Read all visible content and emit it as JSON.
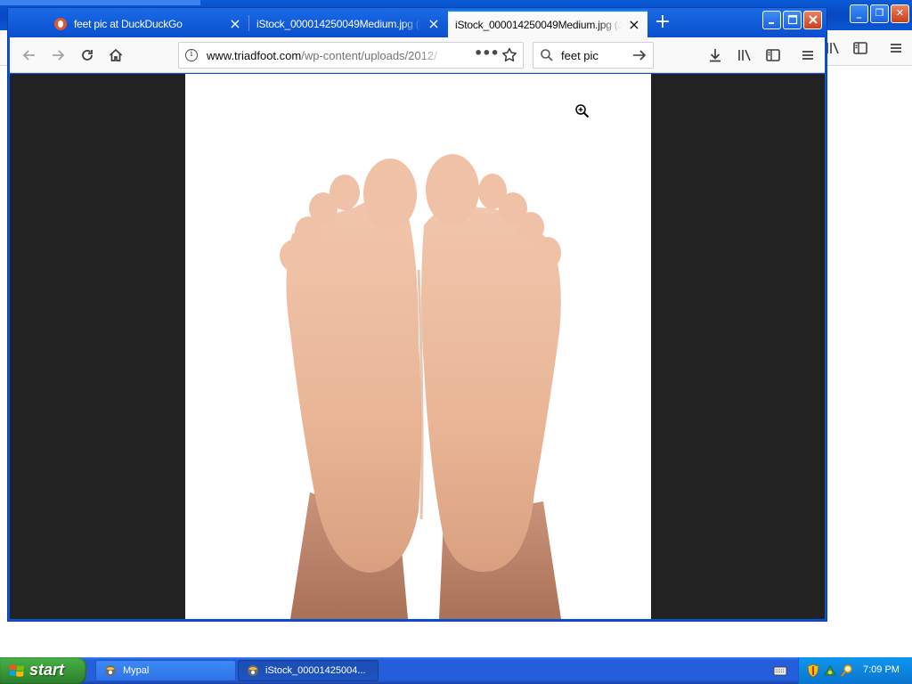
{
  "browser": {
    "tabs": [
      {
        "title": "feet pic at DuckDuckGo",
        "favicon": "duckduckgo-icon",
        "active": false
      },
      {
        "title": "iStock_000014250049Medium.jpg (JPE",
        "favicon": null,
        "active": false
      },
      {
        "title": "iStock_000014250049Medium.jpg (JPE",
        "favicon": null,
        "active": true
      }
    ],
    "url": {
      "domain": "www.triadfoot.com",
      "path": "/wp-content/uploads/2012/"
    },
    "search": {
      "query": "feet pic"
    },
    "content": {
      "image_alt": "iStock_000014250049Medium.jpg",
      "cursor": "zoom-in-icon"
    }
  },
  "taskbar": {
    "start_label": "start",
    "tasks": [
      {
        "label": "Mypal",
        "pressed": false
      },
      {
        "label": "iStock_00001425004...",
        "pressed": true
      }
    ],
    "clock": "7:09 PM"
  },
  "colors": {
    "xp_blue": "#0b4fcd",
    "start_green": "#379336",
    "page_dark": "#222222",
    "toolbar": "#f9f9fa"
  }
}
